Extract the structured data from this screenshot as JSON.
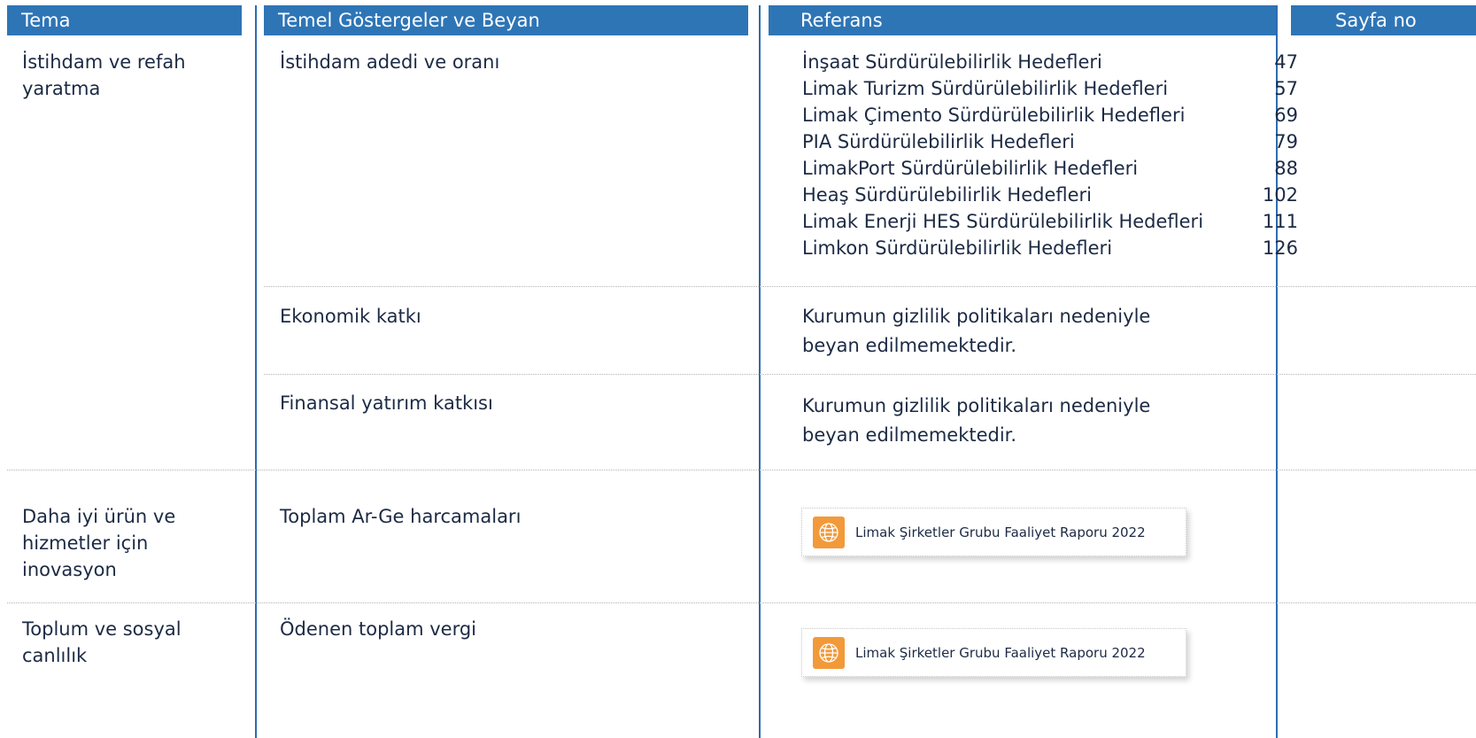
{
  "headers": {
    "tema": "Tema",
    "gosterge": "Temel Göstergeler ve Beyan",
    "referans": "Referans",
    "sayfa": "Sayfa no"
  },
  "rows": {
    "istihdam": {
      "tema_line1": "İstihdam ve refah",
      "tema_line2": "yaratma",
      "indicator": "İstihdam adedi ve oranı",
      "references": [
        {
          "name": "İnşaat Sürdürülebilirlik Hedefleri",
          "page": "47"
        },
        {
          "name": "Limak Turizm Sürdürülebilirlik Hedefleri",
          "page": "57"
        },
        {
          "name": "Limak Çimento Sürdürülebilirlik Hedefleri",
          "page": "69"
        },
        {
          "name": "PIA Sürdürülebilirlik Hedefleri",
          "page": "79"
        },
        {
          "name": "LimakPort Sürdürülebilirlik Hedefleri",
          "page": "88"
        },
        {
          "name": "Heaş Sürdürülebilirlik Hedefleri",
          "page": "102"
        },
        {
          "name": "Limak Enerji HES Sürdürülebilirlik Hedefleri",
          "page": "111"
        },
        {
          "name": "Limkon Sürdürülebilirlik Hedefleri",
          "page": "126"
        }
      ]
    },
    "ekonomik": {
      "indicator": "Ekonomik katkı",
      "ref_line1": "Kurumun gizlilik politikaları nedeniyle",
      "ref_line2": "beyan edilmemektedir."
    },
    "finansal": {
      "indicator": "Finansal yatırım katkısı",
      "ref_line1": "Kurumun gizlilik politikaları nedeniyle",
      "ref_line2": "beyan edilmemektedir."
    },
    "inovasyon": {
      "tema_line1": "Daha iyi ürün ve",
      "tema_line2": "hizmetler için",
      "tema_line3": "inovasyon",
      "indicator": "Toplam Ar-Ge harcamaları",
      "link_label": "Limak Şirketler Grubu Faaliyet Raporu 2022",
      "link_icon": "globe-icon"
    },
    "toplum": {
      "tema_line1": "Toplum ve sosyal",
      "tema_line2": "canlılık",
      "indicator": "Ödenen toplam vergi",
      "link_label": "Limak Şirketler Grubu Faaliyet Raporu 2022",
      "link_icon": "globe-icon"
    }
  },
  "colors": {
    "header_bg": "#2e75b6",
    "divider": "#2e6cb0",
    "icon_bg": "#f29a3a",
    "text": "#1c2a44"
  }
}
